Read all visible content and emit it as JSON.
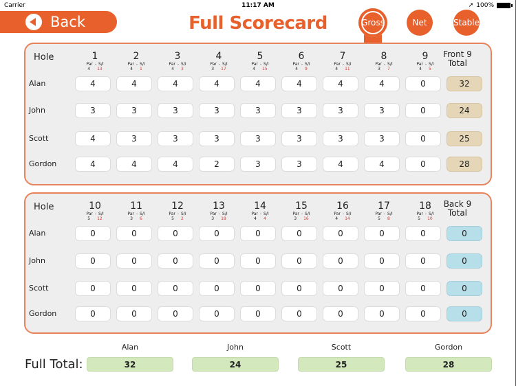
{
  "status_bar": {
    "carrier": "Carrier",
    "time": "11:17 AM",
    "battery": "100%"
  },
  "header": {
    "back_label": "Back",
    "title": "Full Scorecard",
    "modes": [
      {
        "label": "Gross",
        "selected": true
      },
      {
        "label": "Net",
        "selected": false
      },
      {
        "label": "Stable",
        "selected": false
      }
    ]
  },
  "labels": {
    "hole": "Hole",
    "par": "Par",
    "dash": "-",
    "si": "S/I",
    "front_total_1": "Front 9",
    "front_total_2": "Total",
    "back_total_1": "Back 9",
    "back_total_2": "Total",
    "full_total": "Full Total:"
  },
  "colors": {
    "accent": "#e8612c",
    "stroke_index": "#e8342c",
    "front_total": "#e5d6b8",
    "back_total": "#b7dfe9",
    "full_total": "#d3e8bc"
  },
  "front": {
    "holes": [
      {
        "num": "1",
        "par": "4",
        "si": "13"
      },
      {
        "num": "2",
        "par": "4",
        "si": "1"
      },
      {
        "num": "3",
        "par": "4",
        "si": "3"
      },
      {
        "num": "4",
        "par": "3",
        "si": "17"
      },
      {
        "num": "5",
        "par": "4",
        "si": "15"
      },
      {
        "num": "6",
        "par": "4",
        "si": "9"
      },
      {
        "num": "7",
        "par": "4",
        "si": "11"
      },
      {
        "num": "8",
        "par": "3",
        "si": "7"
      },
      {
        "num": "9",
        "par": "4",
        "si": "5"
      }
    ],
    "players": [
      {
        "name": "Alan",
        "scores": [
          "4",
          "4",
          "4",
          "4",
          "4",
          "4",
          "4",
          "4",
          "0"
        ],
        "total": "32"
      },
      {
        "name": "John",
        "scores": [
          "3",
          "3",
          "3",
          "3",
          "3",
          "3",
          "3",
          "3",
          "0"
        ],
        "total": "24"
      },
      {
        "name": "Scott",
        "scores": [
          "4",
          "3",
          "3",
          "3",
          "3",
          "3",
          "3",
          "3",
          "0"
        ],
        "total": "25"
      },
      {
        "name": "Gordon",
        "scores": [
          "4",
          "4",
          "4",
          "2",
          "3",
          "3",
          "4",
          "4",
          "0"
        ],
        "total": "28"
      }
    ]
  },
  "back": {
    "holes": [
      {
        "num": "10",
        "par": "5",
        "si": "12"
      },
      {
        "num": "11",
        "par": "3",
        "si": "6"
      },
      {
        "num": "12",
        "par": "5",
        "si": "2"
      },
      {
        "num": "13",
        "par": "3",
        "si": "18"
      },
      {
        "num": "14",
        "par": "4",
        "si": "4"
      },
      {
        "num": "15",
        "par": "3",
        "si": "16"
      },
      {
        "num": "16",
        "par": "4",
        "si": "14"
      },
      {
        "num": "17",
        "par": "5",
        "si": "8"
      },
      {
        "num": "18",
        "par": "5",
        "si": "10"
      }
    ],
    "players": [
      {
        "name": "Alan",
        "scores": [
          "0",
          "0",
          "0",
          "0",
          "0",
          "0",
          "0",
          "0",
          "0"
        ],
        "total": "0"
      },
      {
        "name": "John",
        "scores": [
          "0",
          "0",
          "0",
          "0",
          "0",
          "0",
          "0",
          "0",
          "0"
        ],
        "total": "0"
      },
      {
        "name": "Scott",
        "scores": [
          "0",
          "0",
          "0",
          "0",
          "0",
          "0",
          "0",
          "0",
          "0"
        ],
        "total": "0"
      },
      {
        "name": "Gordon",
        "scores": [
          "0",
          "0",
          "0",
          "0",
          "0",
          "0",
          "0",
          "0",
          "0"
        ],
        "total": "0"
      }
    ]
  },
  "full_totals": [
    {
      "name": "Alan",
      "total": "32"
    },
    {
      "name": "John",
      "total": "24"
    },
    {
      "name": "Scott",
      "total": "25"
    },
    {
      "name": "Gordon",
      "total": "28"
    }
  ]
}
